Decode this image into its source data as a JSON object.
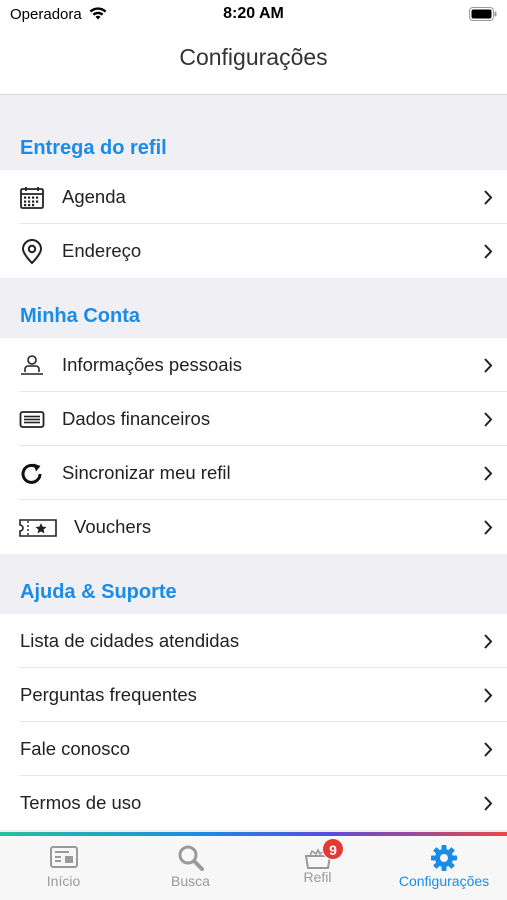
{
  "status_bar": {
    "carrier": "Operadora",
    "time": "8:20 AM"
  },
  "nav": {
    "title": "Configurações"
  },
  "sections": [
    {
      "title": "Entrega do refil",
      "items": [
        {
          "label": "Agenda",
          "icon": "calendar-icon"
        },
        {
          "label": "Endereço",
          "icon": "location-pin-icon"
        }
      ]
    },
    {
      "title": "Minha Conta",
      "items": [
        {
          "label": "Informações pessoais",
          "icon": "person-icon"
        },
        {
          "label": "Dados financeiros",
          "icon": "credit-card-icon"
        },
        {
          "label": "Sincronizar meu refil",
          "icon": "refresh-icon"
        },
        {
          "label": "Vouchers",
          "icon": "voucher-icon"
        }
      ]
    },
    {
      "title": "Ajuda & Suporte",
      "items": [
        {
          "label": "Lista de cidades atendidas"
        },
        {
          "label": "Perguntas frequentes"
        },
        {
          "label": "Fale conosco"
        },
        {
          "label": "Termos de uso"
        }
      ]
    }
  ],
  "tab_bar": {
    "tabs": [
      {
        "label": "Início",
        "icon": "home-card-icon"
      },
      {
        "label": "Busca",
        "icon": "search-icon"
      },
      {
        "label": "Refil",
        "icon": "refill-box-icon",
        "badge": "9"
      },
      {
        "label": "Configurações",
        "icon": "gear-icon",
        "active": true
      }
    ]
  },
  "colors": {
    "accent": "#1a8ce8",
    "badge": "#e53935",
    "background": "#efeff4"
  }
}
